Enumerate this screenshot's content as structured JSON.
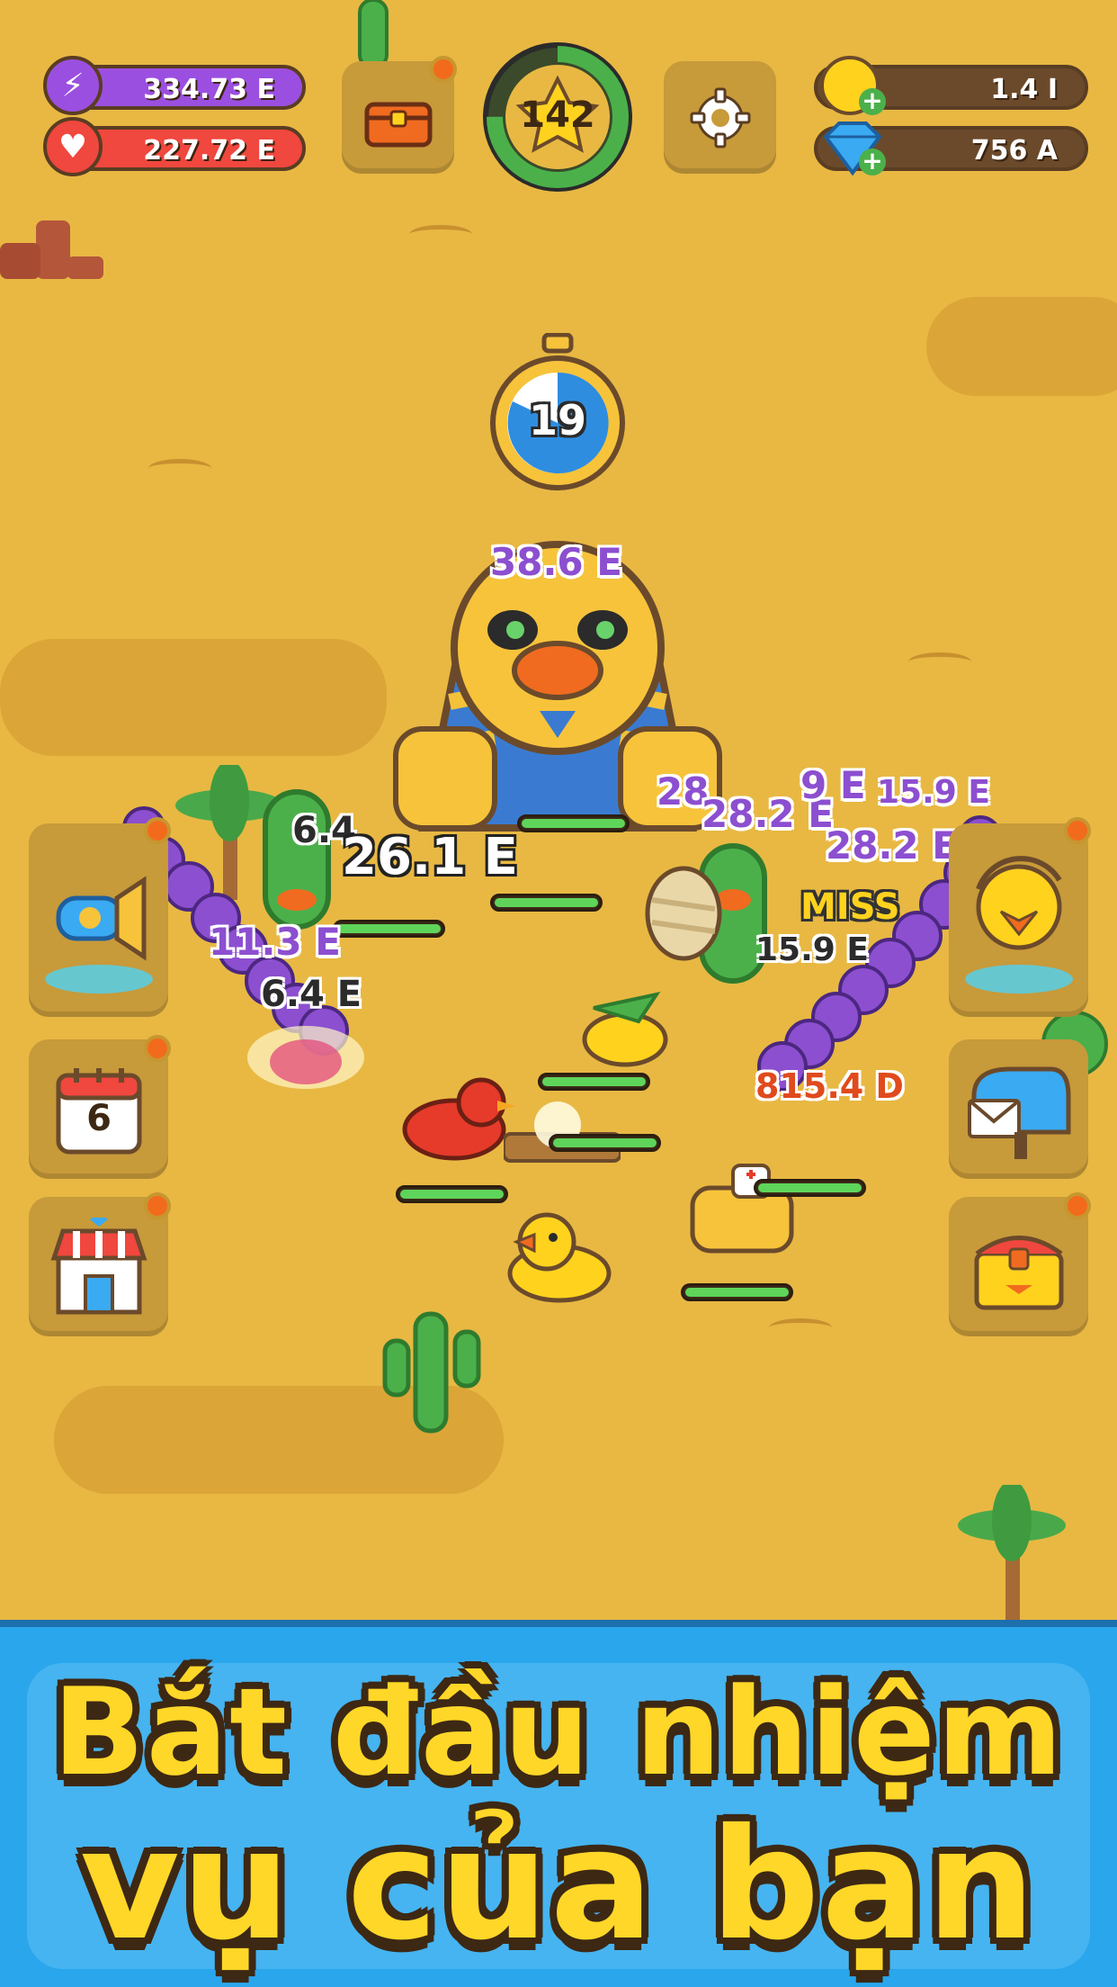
{
  "hud": {
    "energy": "334.73 E",
    "health": "227.72 E",
    "level": "142",
    "gold": "1.4 I",
    "gems": "756 A"
  },
  "boss": {
    "timer": "19"
  },
  "damage_numbers": {
    "d1": "38.6 E",
    "d2": "28.2 E",
    "d3": "28",
    "d4": "9 E",
    "d5": "15.9 E",
    "d6": "28.2 E",
    "d7": "6.4",
    "d8": "26.1 E",
    "d9": "11.3 E",
    "d10": "6.4 E",
    "d11": "MISS",
    "d12": "15.9 E",
    "d13": "815.4 D"
  },
  "side_buttons": {
    "calendar_day": "6"
  },
  "banner": {
    "line1": "Bắt đầu nhiệm",
    "line2": "vụ của bạn"
  },
  "colors": {
    "sand": "#e8b843",
    "banner_blue": "#2aa6ec",
    "headline_yellow": "#ffd728",
    "energy_purple": "#9b4fe0",
    "health_red": "#f0473e",
    "hp_green": "#5fd45a"
  }
}
